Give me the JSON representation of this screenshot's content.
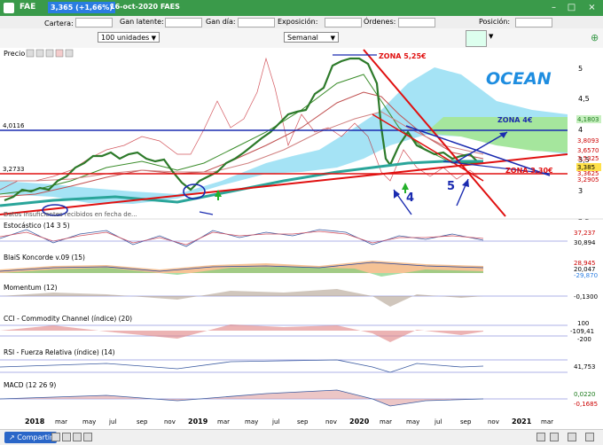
{
  "window": {
    "title": "FAE",
    "price_change_badge": "3,365 (+1,66%)",
    "date_ticker": "16-oct-2020 FAES"
  },
  "infobar": {
    "cartera": "Cartera:",
    "ganancia_latente": "Gan latente:",
    "ganancia_dia": "Gan día:",
    "exposicion": "Exposición:",
    "ordenes": "Órdenes:",
    "posicion": "Posición:"
  },
  "toolbar": {
    "units_select": "100 unidades",
    "period_select": "Semanal"
  },
  "price_panel": {
    "title": "Precio",
    "watermark": "OCEAN",
    "y_ticks": [
      "5",
      "4,5",
      "4",
      "3,5",
      "3",
      "2,5"
    ],
    "left_levels": [
      "4,0116",
      "3,2733"
    ],
    "right_tags": [
      "4,1803",
      "3,8093",
      "3,6570",
      "3,5325",
      "3,385",
      "3,3625",
      "3,2905"
    ],
    "annotations": {
      "zona_top": "ZONA 5,25€",
      "zona_mid": "ZONA 4€",
      "zona_low": "ZONA 3,30€",
      "wave4": "4",
      "wave5": "5"
    },
    "footer_text": "Datos insuficientes recibidos en fecha de..."
  },
  "indicators": [
    {
      "title": "Estocástico (14 3 5)",
      "values": [
        "37,237",
        "30,894"
      ]
    },
    {
      "title": "BlaiS Koncorde v.09 (15)",
      "values": [
        "28,945",
        "20,047",
        "-29,870"
      ]
    },
    {
      "title": "Momentum (12)",
      "values": [
        "-0,1300"
      ]
    },
    {
      "title": "CCI - Commodity Channel (índice) (20)",
      "values": [
        "100",
        "-109,41",
        "-200"
      ]
    },
    {
      "title": "RSI - Fuerza Relativa (índice) (14)",
      "values": [
        "41,753"
      ]
    },
    {
      "title": "MACD (12 26 9)",
      "values": [
        "0,0220",
        "-0,1685"
      ]
    }
  ],
  "time_axis": {
    "labels": [
      "2018",
      "mar",
      "may",
      "jul",
      "sep",
      "nov",
      "2019",
      "mar",
      "may",
      "jul",
      "sep",
      "nov",
      "2020",
      "mar",
      "may",
      "jul",
      "sep",
      "nov",
      "2021",
      "mar"
    ]
  },
  "bottombar": {
    "share_label": "Compartir"
  },
  "colors": {
    "titlebar": "#3a9a4a",
    "price_badge": "#2a7de1",
    "zone_red": "#e01010",
    "zone_blue": "#1a2bb0",
    "cloud": "#80d8f0",
    "cloud_green": "#9de08a",
    "watermark": "#1e8de0"
  }
}
